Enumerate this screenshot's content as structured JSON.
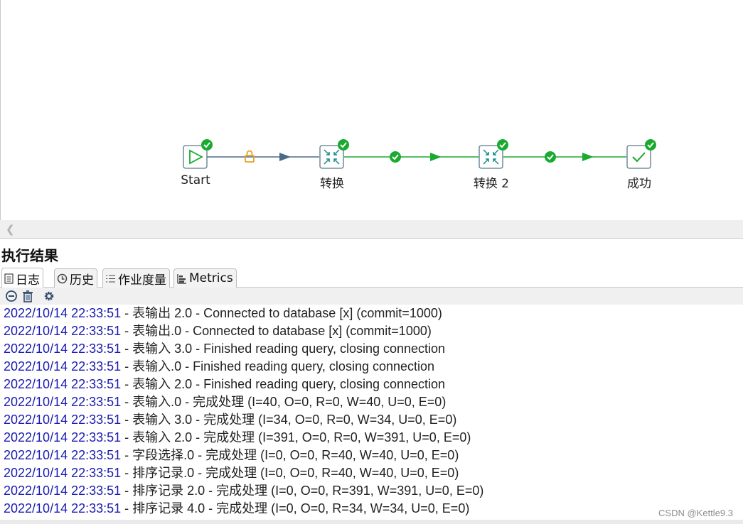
{
  "canvas": {
    "nodes": [
      {
        "id": "start",
        "label": "Start",
        "icon": "play-icon",
        "status": "success"
      },
      {
        "id": "t1",
        "label": "转换",
        "icon": "transform-icon",
        "status": "success"
      },
      {
        "id": "t2",
        "label": "转换 2",
        "icon": "transform-icon",
        "status": "success"
      },
      {
        "id": "ok",
        "label": "成功",
        "icon": "success-check-icon",
        "status": "success"
      }
    ],
    "hops": [
      {
        "from": "start",
        "to": "t1",
        "type": "unconditional",
        "icon": "lock-icon",
        "color": "#4a6a8a"
      },
      {
        "from": "t1",
        "to": "t2",
        "type": "on-success",
        "icon": "check-icon",
        "color": "#1aaa30"
      },
      {
        "from": "t2",
        "to": "ok",
        "type": "on-success",
        "icon": "check-icon",
        "color": "#1aaa30"
      }
    ]
  },
  "results": {
    "title": "执行结果",
    "tabs": [
      {
        "label": "日志",
        "icon": "log-icon",
        "active": true
      },
      {
        "label": "历史",
        "icon": "history-icon",
        "active": false
      },
      {
        "label": "作业度量",
        "icon": "job-metrics-icon",
        "active": false
      },
      {
        "label": "Metrics",
        "icon": "metrics-icon",
        "active": false
      }
    ],
    "toolbar": [
      "stop-icon",
      "trash-icon",
      "settings-icon"
    ],
    "log": [
      {
        "ts": "2022/10/14 22:33:51",
        "msg": " - 表输出 2.0 - Connected to database [x] (commit=1000)"
      },
      {
        "ts": "2022/10/14 22:33:51",
        "msg": " - 表输出.0 - Connected to database [x] (commit=1000)"
      },
      {
        "ts": "2022/10/14 22:33:51",
        "msg": " - 表输入 3.0 - Finished reading query, closing connection"
      },
      {
        "ts": "2022/10/14 22:33:51",
        "msg": " - 表输入.0 - Finished reading query, closing connection"
      },
      {
        "ts": "2022/10/14 22:33:51",
        "msg": " - 表输入 2.0 - Finished reading query, closing connection"
      },
      {
        "ts": "2022/10/14 22:33:51",
        "msg": " - 表输入.0 - 完成处理 (I=40, O=0, R=0, W=40, U=0, E=0)"
      },
      {
        "ts": "2022/10/14 22:33:51",
        "msg": " - 表输入 3.0 - 完成处理 (I=34, O=0, R=0, W=34, U=0, E=0)"
      },
      {
        "ts": "2022/10/14 22:33:51",
        "msg": " - 表输入 2.0 - 完成处理 (I=391, O=0, R=0, W=391, U=0, E=0)"
      },
      {
        "ts": "2022/10/14 22:33:51",
        "msg": " - 字段选择.0 - 完成处理 (I=0, O=0, R=40, W=40, U=0, E=0)"
      },
      {
        "ts": "2022/10/14 22:33:51",
        "msg": " - 排序记录.0 - 完成处理 (I=0, O=0, R=40, W=40, U=0, E=0)"
      },
      {
        "ts": "2022/10/14 22:33:51",
        "msg": " - 排序记录 2.0 - 完成处理 (I=0, O=0, R=391, W=391, U=0, E=0)"
      },
      {
        "ts": "2022/10/14 22:33:51",
        "msg": " - 排序记录 4.0 - 完成处理 (I=0, O=0, R=34, W=34, U=0, E=0)"
      }
    ]
  },
  "watermark": "CSDN @Kettle9.3",
  "colors": {
    "timestamp": "#1a1ab0",
    "success": "#1aaa30",
    "hop_default": "#4a6a8a",
    "lock": "#e8a020"
  }
}
